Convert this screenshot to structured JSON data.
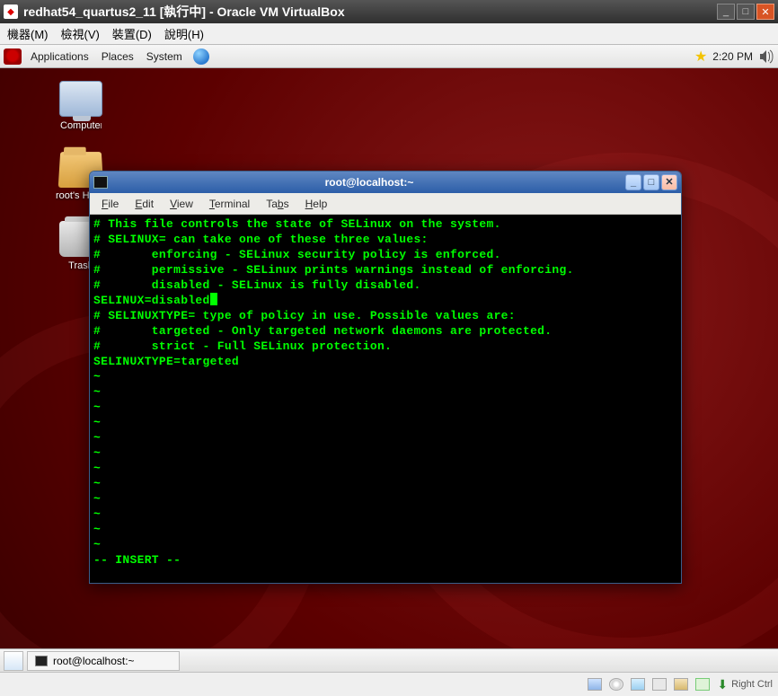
{
  "vbox": {
    "title": "redhat54_quartus2_11 [執行中] - Oracle VM VirtualBox",
    "menu": {
      "machine": "機器(M)",
      "view": "檢視(V)",
      "devices": "裝置(D)",
      "help": "說明(H)"
    },
    "status": {
      "host_key": "Right Ctrl"
    }
  },
  "gnome": {
    "menu": {
      "apps": "Applications",
      "places": "Places",
      "system": "System"
    },
    "clock": "2:20 PM",
    "icons": {
      "computer": "Computer",
      "home": "root's Home",
      "trash": "Trash"
    },
    "taskbar": {
      "term": "root@localhost:~"
    }
  },
  "terminal": {
    "title": "root@localhost:~",
    "menu": {
      "file": "File",
      "edit": "Edit",
      "view": "View",
      "terminal": "Terminal",
      "tabs": "Tabs",
      "help": "Help"
    },
    "lines": [
      "# This file controls the state of SELinux on the system.",
      "# SELINUX= can take one of these three values:",
      "#       enforcing - SELinux security policy is enforced.",
      "#       permissive - SELinux prints warnings instead of enforcing.",
      "#       disabled - SELinux is fully disabled.",
      "SELINUX=disabled",
      "# SELINUXTYPE= type of policy in use. Possible values are:",
      "#       targeted - Only targeted network daemons are protected.",
      "#       strict - Full SELinux protection.",
      "SELINUXTYPE=targeted"
    ],
    "status_line": "-- INSERT --"
  }
}
